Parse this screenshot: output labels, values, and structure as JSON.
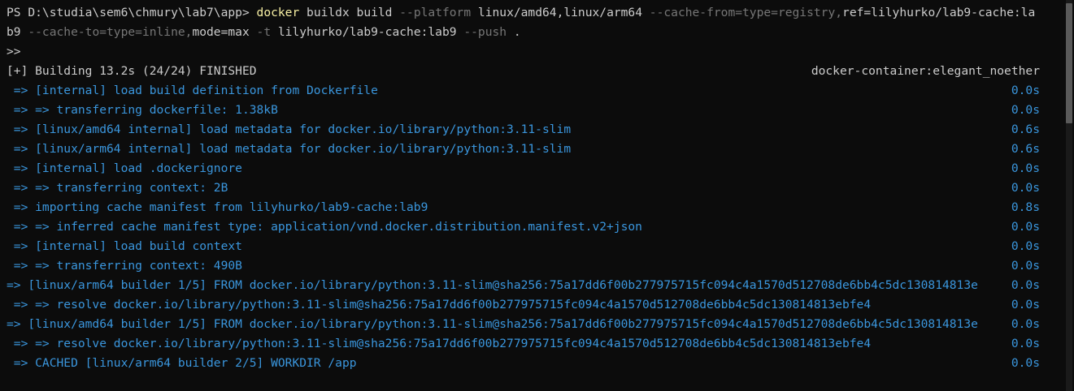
{
  "command": {
    "prompt": "PS D:\\studia\\sem6\\chmury\\lab7\\app> ",
    "exe": "docker",
    "subcmd": " buildx build ",
    "flag_platform": "--platform",
    "platform_value": " linux/amd64,linux/arm64 ",
    "flag_cache_from": "--cache-from=type=registry,",
    "cache_from_ref": "ref=lilyhurko/lab9-cache:la",
    "line2_start": "b9",
    "flag_cache_to": " --cache-to=type=inline,",
    "cache_to_mode": "mode=max ",
    "flag_t": "-t ",
    "tag_value": "lilyhurko/lab9-cache:lab9 ",
    "flag_push": "--push ",
    "dot": ".",
    "continuation": ">>"
  },
  "header": {
    "status": "[+] Building 13.2s (24/24) FINISHED",
    "builder": "docker-container:elegant_noether"
  },
  "steps": [
    {
      "text": " => [internal] load build definition from Dockerfile",
      "time": "0.0s"
    },
    {
      "text": " => => transferring dockerfile: 1.38kB",
      "time": "0.0s"
    },
    {
      "text": " => [linux/amd64 internal] load metadata for docker.io/library/python:3.11-slim",
      "time": "0.6s"
    },
    {
      "text": " => [linux/arm64 internal] load metadata for docker.io/library/python:3.11-slim",
      "time": "0.6s"
    },
    {
      "text": " => [internal] load .dockerignore",
      "time": "0.0s"
    },
    {
      "text": " => => transferring context: 2B",
      "time": "0.0s"
    },
    {
      "text": " => importing cache manifest from lilyhurko/lab9-cache:lab9",
      "time": "0.8s"
    },
    {
      "text": " => => inferred cache manifest type: application/vnd.docker.distribution.manifest.v2+json",
      "time": "0.0s"
    },
    {
      "text": " => [internal] load build context",
      "time": "0.0s"
    },
    {
      "text": " => => transferring context: 490B",
      "time": "0.0s"
    },
    {
      "text": "=> [linux/arm64 builder 1/5] FROM docker.io/library/python:3.11-slim@sha256:75a17dd6f00b277975715fc094c4a1570d512708de6bb4c5dc130814813e",
      "time": "0.0s"
    },
    {
      "text": " => => resolve docker.io/library/python:3.11-slim@sha256:75a17dd6f00b277975715fc094c4a1570d512708de6bb4c5dc130814813ebfe4",
      "time": "0.0s"
    },
    {
      "text": "=> [linux/amd64 builder 1/5] FROM docker.io/library/python:3.11-slim@sha256:75a17dd6f00b277975715fc094c4a1570d512708de6bb4c5dc130814813e",
      "time": "0.0s"
    },
    {
      "text": " => => resolve docker.io/library/python:3.11-slim@sha256:75a17dd6f00b277975715fc094c4a1570d512708de6bb4c5dc130814813ebfe4",
      "time": "0.0s"
    },
    {
      "text": " => CACHED [linux/arm64 builder 2/5] WORKDIR /app",
      "time": "0.0s"
    }
  ],
  "colors": {
    "background": "#0c0c0c",
    "foreground": "#cccccc",
    "command": "#f9f1a5",
    "flag": "#767676",
    "step": "#3a96dd"
  }
}
